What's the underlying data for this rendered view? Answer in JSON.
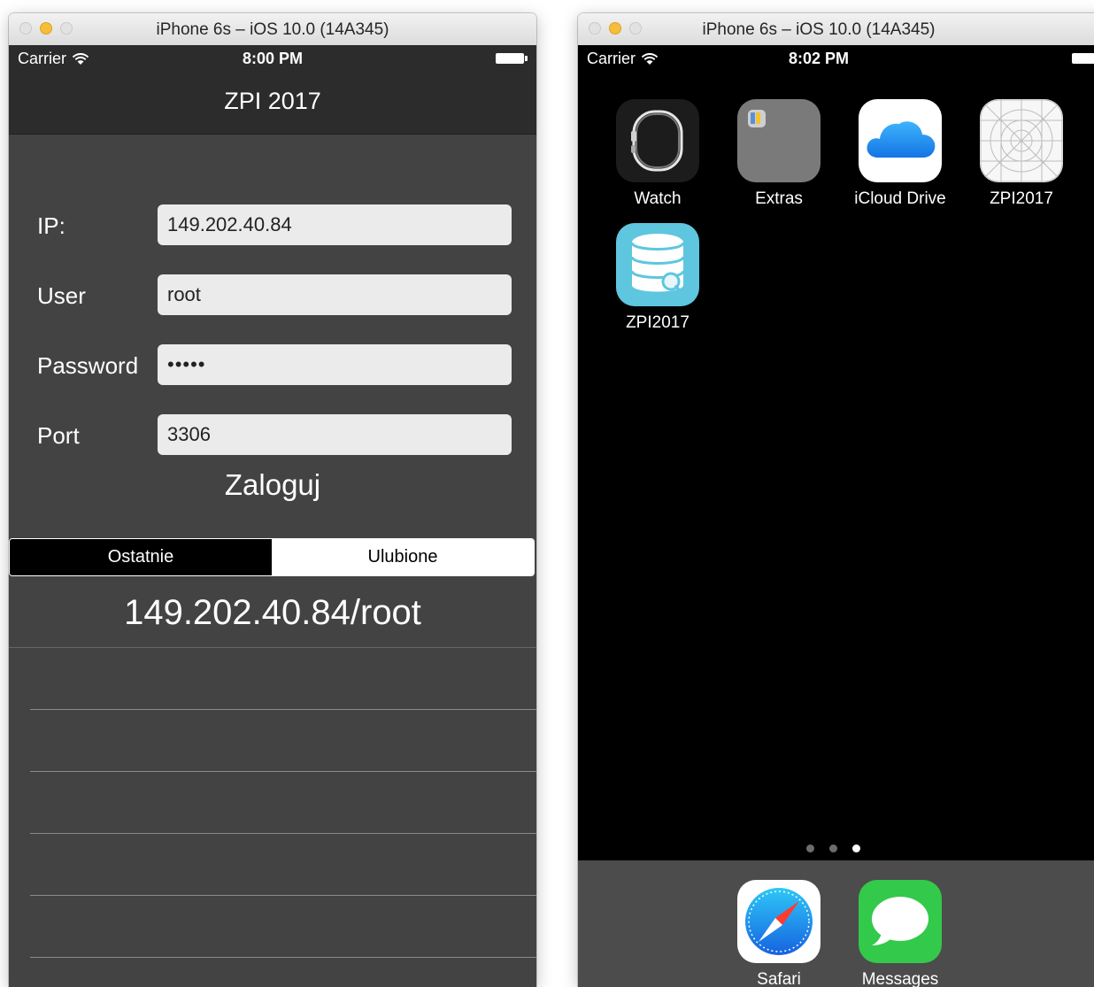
{
  "left_window": {
    "title": "iPhone 6s – iOS 10.0 (14A345)",
    "status": {
      "carrier": "Carrier",
      "time": "8:00 PM"
    },
    "nav_title": "ZPI 2017",
    "form": {
      "ip_label": "IP:",
      "ip_value": "149.202.40.84",
      "user_label": "User",
      "user_value": "root",
      "password_label": "Password",
      "password_value": "•••••",
      "port_label": "Port",
      "port_value": "3306"
    },
    "login_button": "Zaloguj",
    "segments": [
      {
        "label": "Ostatnie",
        "selected": false
      },
      {
        "label": "Ulubione",
        "selected": true
      }
    ],
    "history": [
      "149.202.40.84/root",
      "",
      "",
      "",
      "",
      ""
    ]
  },
  "right_window": {
    "title": "iPhone 6s – iOS 10.0 (14A345)",
    "status": {
      "carrier": "Carrier",
      "time": "8:02 PM"
    },
    "apps": [
      {
        "label": "Watch",
        "icon": "watch-app-icon"
      },
      {
        "label": "Extras",
        "icon": "folder-icon"
      },
      {
        "label": "iCloud Drive",
        "icon": "cloud-icon"
      },
      {
        "label": "ZPI2017",
        "icon": "placeholder-app-icon"
      },
      {
        "label": "ZPI2017",
        "icon": "database-search-icon"
      }
    ],
    "page_dots": {
      "count": 3,
      "active_index": 2
    },
    "dock": [
      {
        "label": "Safari",
        "icon": "compass-icon"
      },
      {
        "label": "Messages",
        "icon": "speech-bubble-icon"
      }
    ]
  },
  "colors": {
    "app_background": "#434343",
    "nav_bar": "#2c2c2c",
    "input_background": "#ebebeb",
    "home_background": "#000000",
    "dock_background": "#4c4c4c",
    "icloud_blue": "#1e8ef7",
    "zpi_teal": "#5ec6de",
    "messages_green": "#33c94a"
  }
}
